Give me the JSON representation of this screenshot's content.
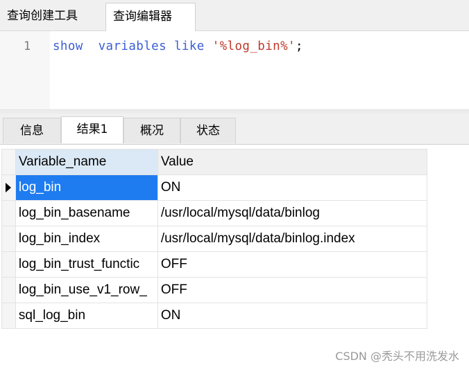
{
  "top_tabs": [
    "查询创建工具",
    "查询编辑器"
  ],
  "editor": {
    "line_number": "1",
    "tokens": {
      "kw1": "show",
      "kw2": "variables",
      "kw3": "like",
      "string": "'%log_bin%'",
      "end": ";"
    }
  },
  "result_tabs": [
    "信息",
    "结果1",
    "概况",
    "状态"
  ],
  "grid": {
    "headers": [
      "Variable_name",
      "Value"
    ],
    "rows": [
      {
        "name": "log_bin",
        "value": "ON"
      },
      {
        "name": "log_bin_basename",
        "value": "/usr/local/mysql/data/binlog"
      },
      {
        "name": "log_bin_index",
        "value": "/usr/local/mysql/data/binlog.index"
      },
      {
        "name": "log_bin_trust_functic",
        "value": "OFF"
      },
      {
        "name": "log_bin_use_v1_row_",
        "value": "OFF"
      },
      {
        "name": "sql_log_bin",
        "value": "ON"
      }
    ]
  },
  "watermark": "CSDN @秃头不用洗发水"
}
